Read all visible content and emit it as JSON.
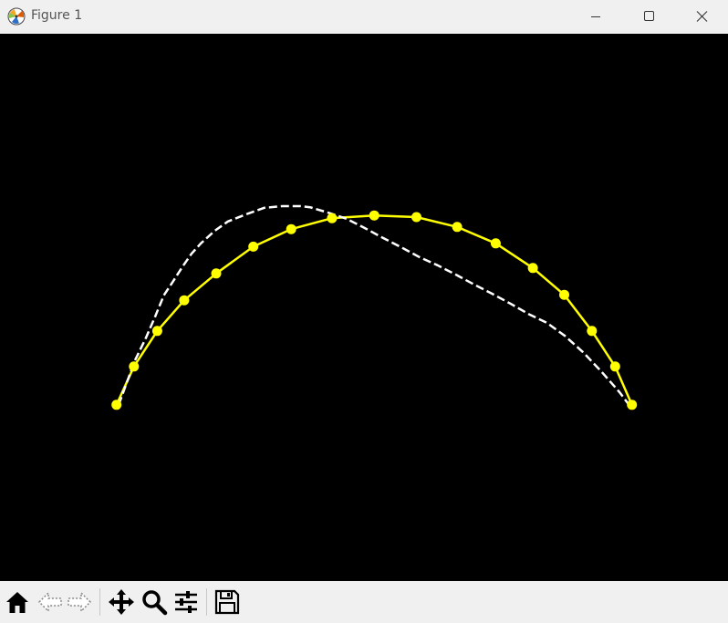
{
  "window": {
    "title": "Figure 1",
    "buttons": {
      "minimize": "minimize-icon",
      "maximize": "maximize-icon",
      "close": "close-icon"
    }
  },
  "toolbar": {
    "items": [
      "home-icon",
      "back-icon",
      "forward-icon",
      "pan-icon",
      "zoom-icon",
      "configure-subplots-icon",
      "save-icon"
    ]
  },
  "colors": {
    "background": "#000000",
    "marker_series": "#ffff00",
    "dashed_series": "#ffffff"
  },
  "chart_data": {
    "type": "line",
    "title": "",
    "xlabel": "",
    "ylabel": "",
    "axes_visible": false,
    "xlim": [
      0,
      1
    ],
    "ylim": [
      0,
      1
    ],
    "series": [
      {
        "style": "solid-with-markers",
        "color": "#ffff00",
        "x": [
          0.16,
          0.184,
          0.216,
          0.253,
          0.297,
          0.348,
          0.4,
          0.456,
          0.514,
          0.572,
          0.628,
          0.681,
          0.732,
          0.775,
          0.813,
          0.845,
          0.868
        ],
        "y": [
          0.322,
          0.392,
          0.457,
          0.513,
          0.562,
          0.611,
          0.643,
          0.663,
          0.668,
          0.665,
          0.647,
          0.617,
          0.572,
          0.523,
          0.457,
          0.392,
          0.322
        ]
      },
      {
        "style": "dashed",
        "color": "#ffffff",
        "x": [
          0.163,
          0.185,
          0.2,
          0.213,
          0.225,
          0.238,
          0.251,
          0.263,
          0.276,
          0.295,
          0.313,
          0.338,
          0.363,
          0.388,
          0.413,
          0.426,
          0.451,
          0.476,
          0.501,
          0.526,
          0.551,
          0.576,
          0.601,
          0.626,
          0.651,
          0.676,
          0.701,
          0.726,
          0.751,
          0.776,
          0.801,
          0.826,
          0.851,
          0.864
        ],
        "y": [
          0.322,
          0.402,
          0.443,
          0.483,
          0.522,
          0.548,
          0.575,
          0.598,
          0.617,
          0.64,
          0.657,
          0.67,
          0.682,
          0.685,
          0.685,
          0.683,
          0.673,
          0.662,
          0.645,
          0.627,
          0.61,
          0.592,
          0.577,
          0.56,
          0.542,
          0.525,
          0.507,
          0.488,
          0.472,
          0.448,
          0.418,
          0.383,
          0.345,
          0.322
        ]
      }
    ]
  }
}
